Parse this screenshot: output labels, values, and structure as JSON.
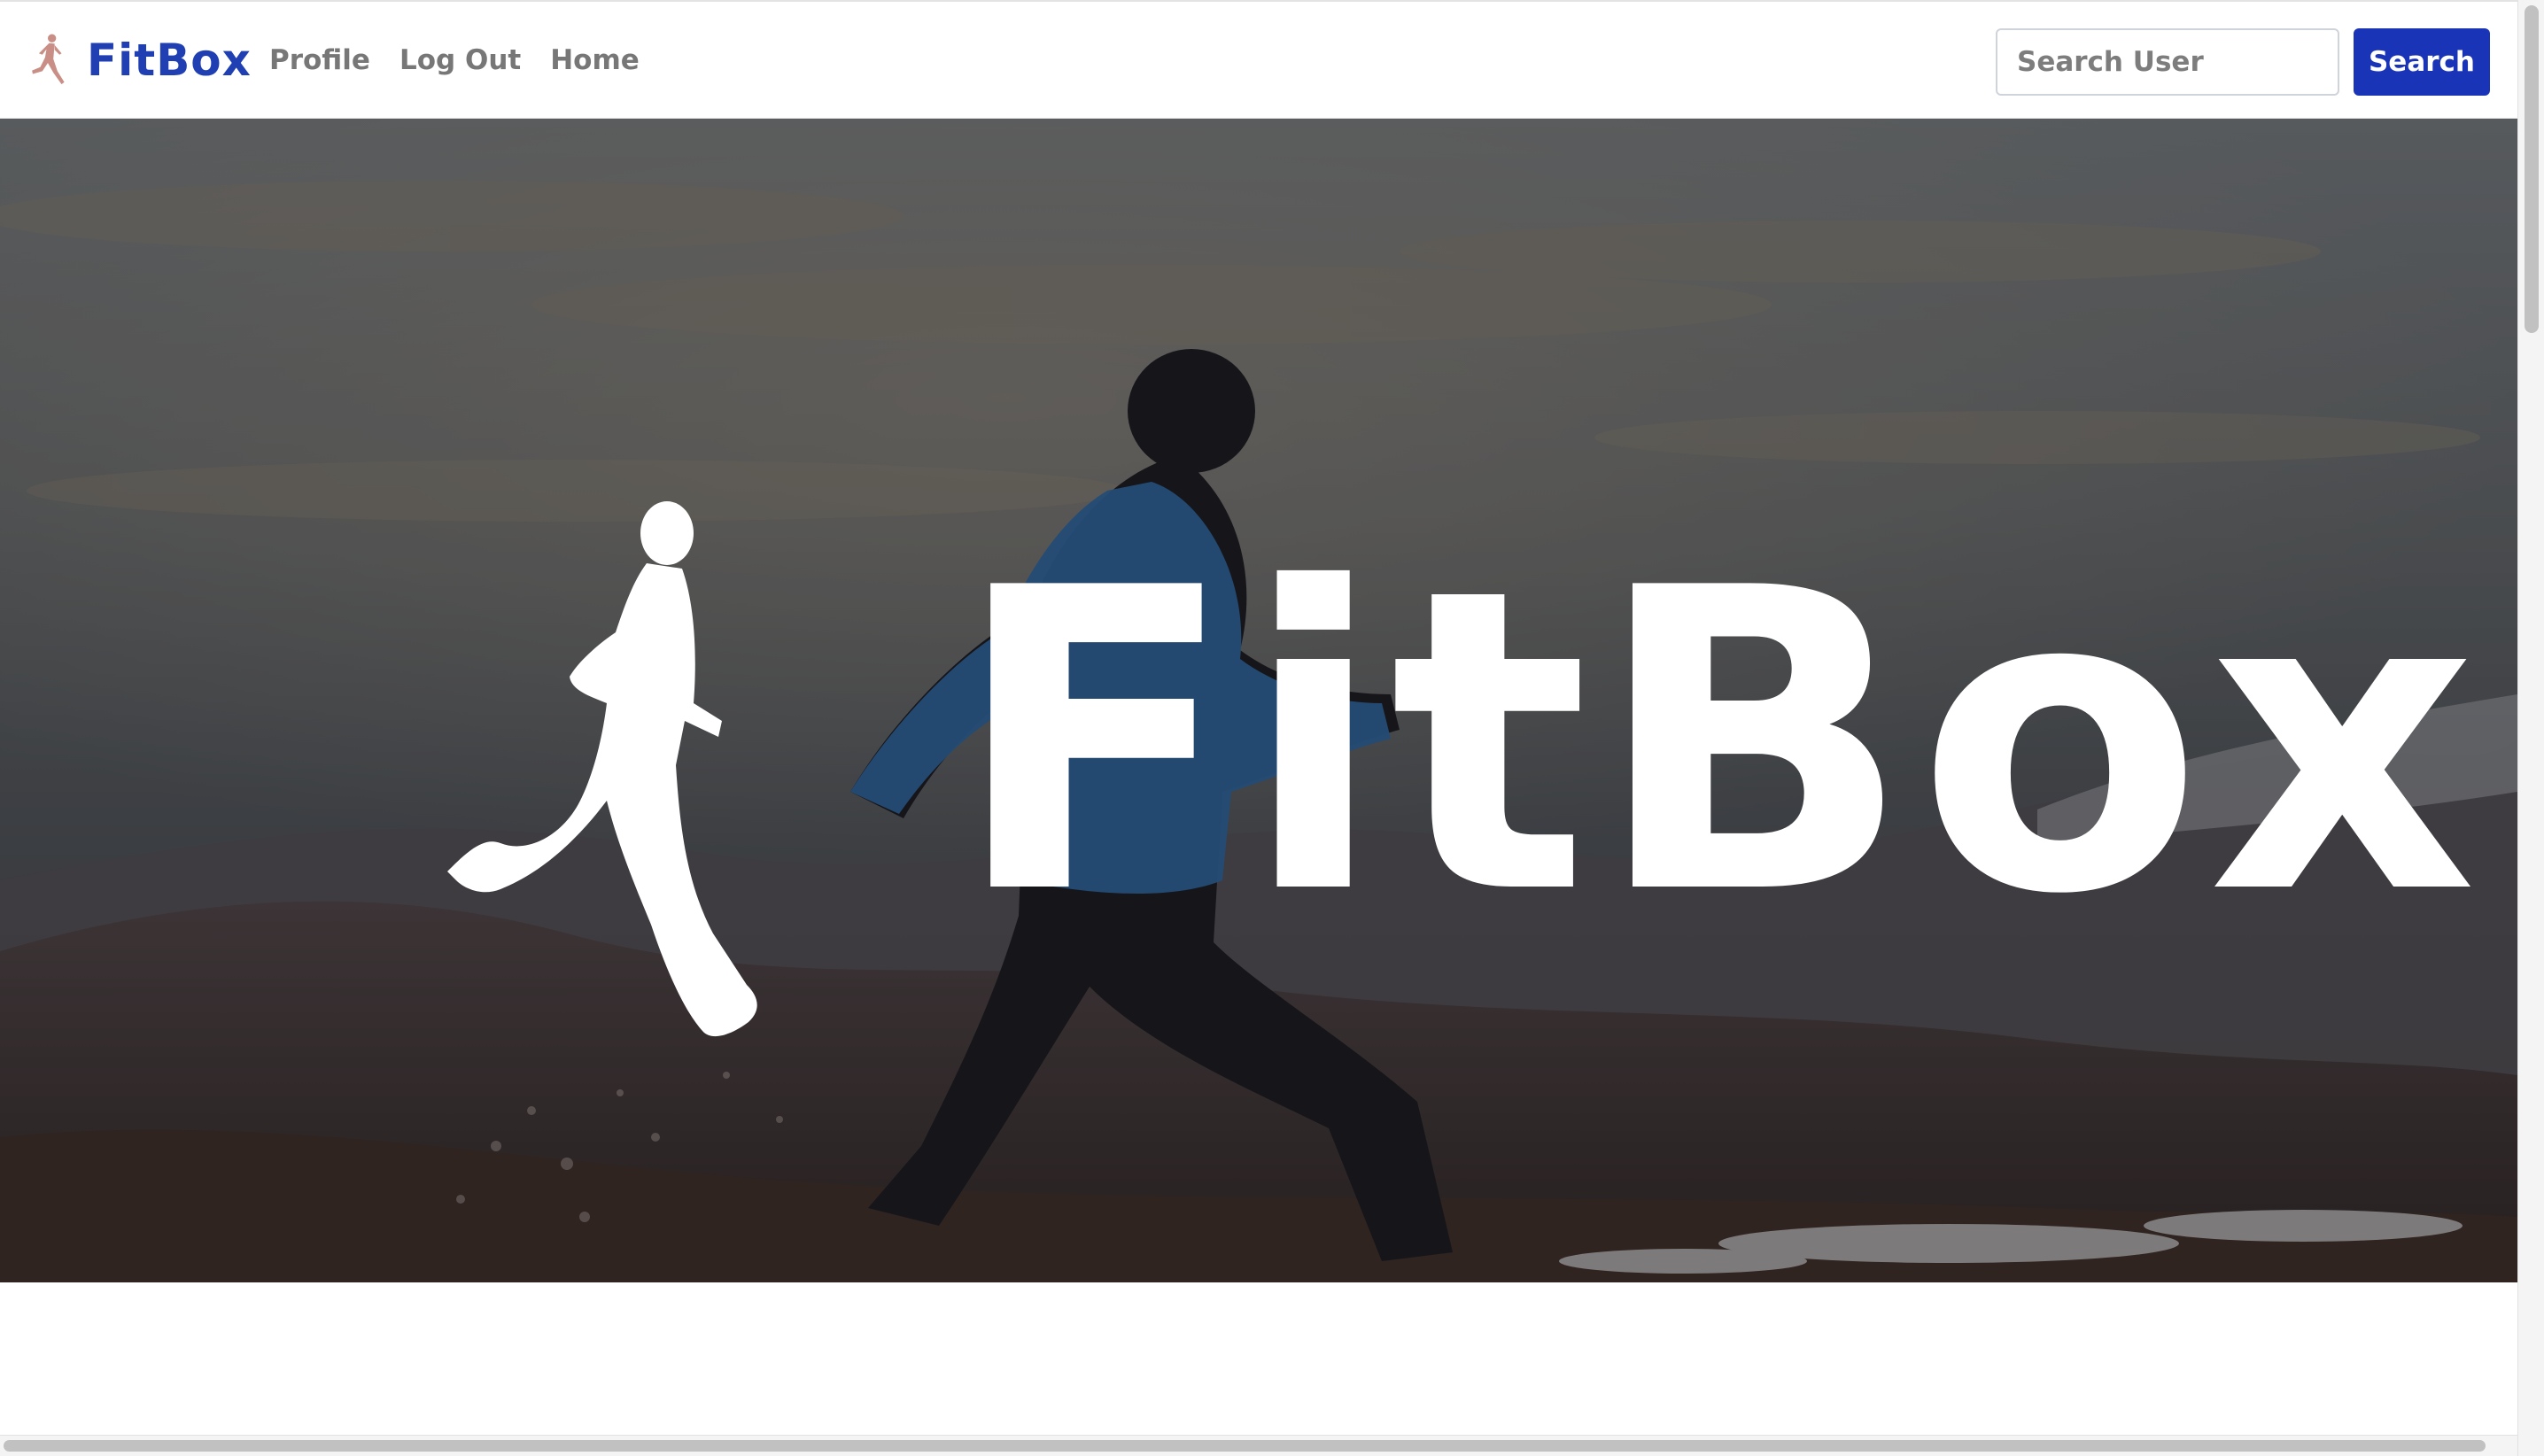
{
  "navbar": {
    "brand": {
      "name": "FitBox",
      "icon": "runner-icon"
    },
    "links": [
      {
        "label": "Profile"
      },
      {
        "label": "Log Out"
      },
      {
        "label": "Home"
      }
    ],
    "search": {
      "placeholder": "Search User",
      "value": "",
      "button_label": "Search"
    }
  },
  "hero": {
    "title": "FitBox",
    "logo_icon": "runner-silhouette-icon"
  },
  "colors": {
    "brand": "#1f3fb3",
    "button": "#1a34b8",
    "nav_link": "#777777",
    "runner_icon": "#c98f86"
  }
}
